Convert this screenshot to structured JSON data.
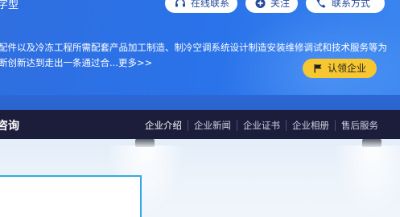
{
  "hero": {
    "type_text": "字型",
    "actions": [
      {
        "label": "在线联系",
        "icon": "headset-icon"
      },
      {
        "label": "关注",
        "icon": "plus-circle-icon"
      },
      {
        "label": "联系方式",
        "icon": "phone-icon"
      }
    ],
    "description_line1": "配件以及冷冻工程所需配套产品加工制造、制冷空调系统设计制造安装维修调试和技术服务等为",
    "description_line2": "断创新达到走出一条通过合...更多>>",
    "claim_label": "认领企业",
    "claim_icon": "flag-icon"
  },
  "navbar": {
    "title": "咨询",
    "items": [
      "企业介绍",
      "企业新闻",
      "企业证书",
      "企业相册",
      "售后服务"
    ]
  },
  "colors": {
    "hero_blue": "#2a73ea",
    "navbar_bg": "#1c1d3b",
    "claim_yellow": "#f6c731",
    "panel_border": "#34a7e8"
  }
}
